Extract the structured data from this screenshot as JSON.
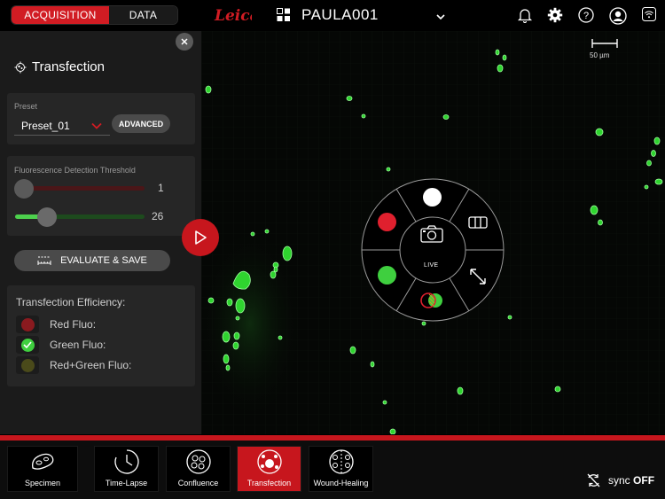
{
  "header": {
    "tabs": [
      {
        "label": "ACQUISITION",
        "active": true
      },
      {
        "label": "DATA",
        "active": false
      }
    ],
    "logo_text": "Leica",
    "project_title": "PAULA001",
    "icons": [
      "grid-icon",
      "chevron-down-icon",
      "bell-icon",
      "gear-icon",
      "help-icon",
      "user-icon",
      "wifi-icon"
    ]
  },
  "panel": {
    "title": "Transfection",
    "preset": {
      "label": "Preset",
      "value": "Preset_01",
      "advanced_label": "ADVANCED"
    },
    "threshold": {
      "label": "Fluorescence Detection Threshold",
      "red": {
        "value": "1",
        "fraction": 0.0,
        "color": "#c7161d"
      },
      "green": {
        "value": "26",
        "fraction": 0.23,
        "color": "#4dd04d"
      }
    },
    "evaluate_label": "EVALUATE & SAVE",
    "efficiency": {
      "title": "Transfection Efficiency:",
      "items": [
        {
          "label": "Red Fluo:",
          "color": "#8a1a1f",
          "checked": false
        },
        {
          "label": "Green Fluo:",
          "color": "#3fcf3f",
          "checked": true
        },
        {
          "label": "Red+Green Fluo:",
          "color": "#4a4a1a",
          "checked": false
        }
      ]
    }
  },
  "viewport": {
    "scale_label": "50 µm",
    "radial_menu": {
      "center_label": "LIVE",
      "icons": [
        "white-channel-icon",
        "red-channel-icon",
        "green-channel-icon",
        "overlay-channel-icon",
        "camera-icon",
        "columns-icon",
        "expand-icon"
      ]
    }
  },
  "modules": [
    {
      "label": "Specimen",
      "active": false
    },
    {
      "label": "Time-Lapse",
      "active": false
    },
    {
      "label": "Confluence",
      "active": false
    },
    {
      "label": "Transfection",
      "active": true
    },
    {
      "label": "Wound-Healing",
      "active": false
    }
  ],
  "sync": {
    "label": "sync",
    "state": "OFF"
  },
  "colors": {
    "accent": "#c7161d",
    "green_fluo": "#3fcf3f",
    "panel": "#1b1b1b"
  }
}
